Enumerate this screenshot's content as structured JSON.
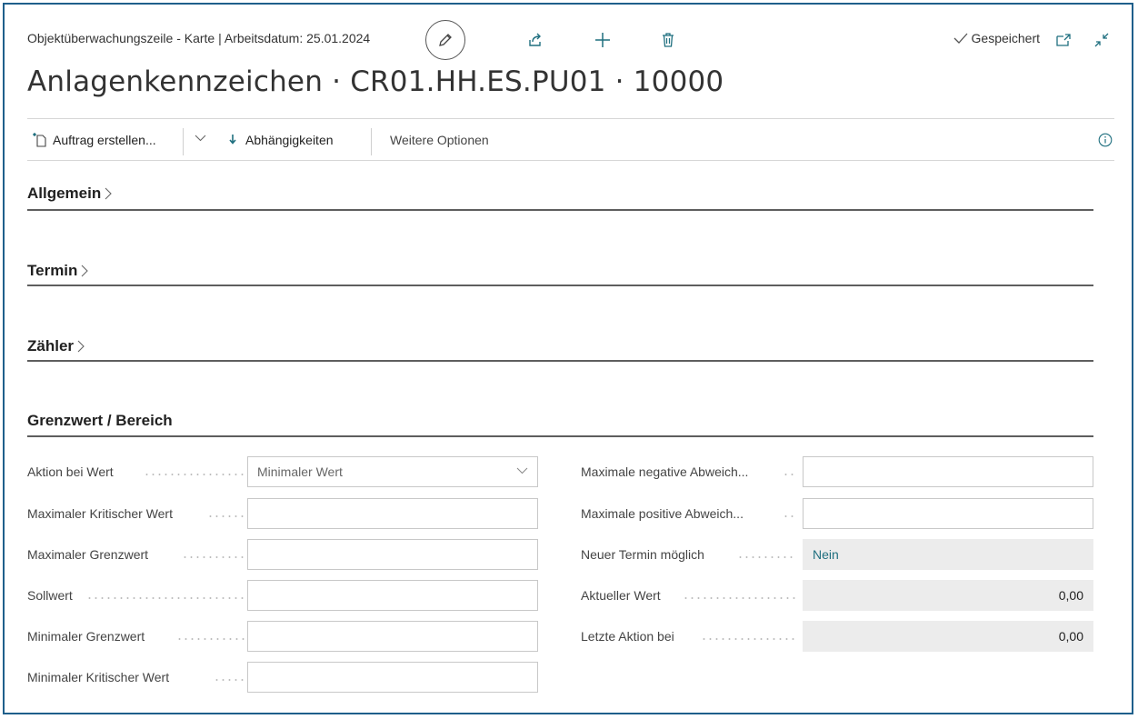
{
  "header": {
    "subtitle": "Objektüberwachungszeile - Karte | Arbeitsdatum: 25.01.2024",
    "saved_label": "Gespeichert",
    "title": "Anlagenkennzeichen · CR01.HH.ES.PU01 · 10000"
  },
  "actions": {
    "create_order": "Auftrag erstellen...",
    "dependencies": "Abhängigkeiten",
    "more_options": "Weitere Optionen"
  },
  "sections": {
    "general": "Allgemein",
    "schedule": "Termin",
    "counter": "Zähler",
    "limit": "Grenzwert / Bereich"
  },
  "fields_left": [
    {
      "label": "Aktion bei Wert",
      "value": "Minimaler Wert",
      "type": "select"
    },
    {
      "label": "Maximaler Kritischer Wert",
      "value": ""
    },
    {
      "label": "Maximaler Grenzwert",
      "value": ""
    },
    {
      "label": "Sollwert",
      "value": ""
    },
    {
      "label": "Minimaler Grenzwert",
      "value": ""
    },
    {
      "label": "Minimaler Kritischer Wert",
      "value": ""
    }
  ],
  "fields_right": [
    {
      "label": "Maximale negative Abweich...",
      "value": ""
    },
    {
      "label": "Maximale positive Abweich...",
      "value": ""
    },
    {
      "label": "Neuer Termin möglich",
      "value": "Nein"
    },
    {
      "label": "Aktueller Wert",
      "value": "0,00"
    },
    {
      "label": "Letzte Aktion bei",
      "value": "0,00"
    }
  ],
  "colors": {
    "accent": "#1f6f7f",
    "frame": "#1f5f8b",
    "readonly_bg": "#ececec"
  }
}
